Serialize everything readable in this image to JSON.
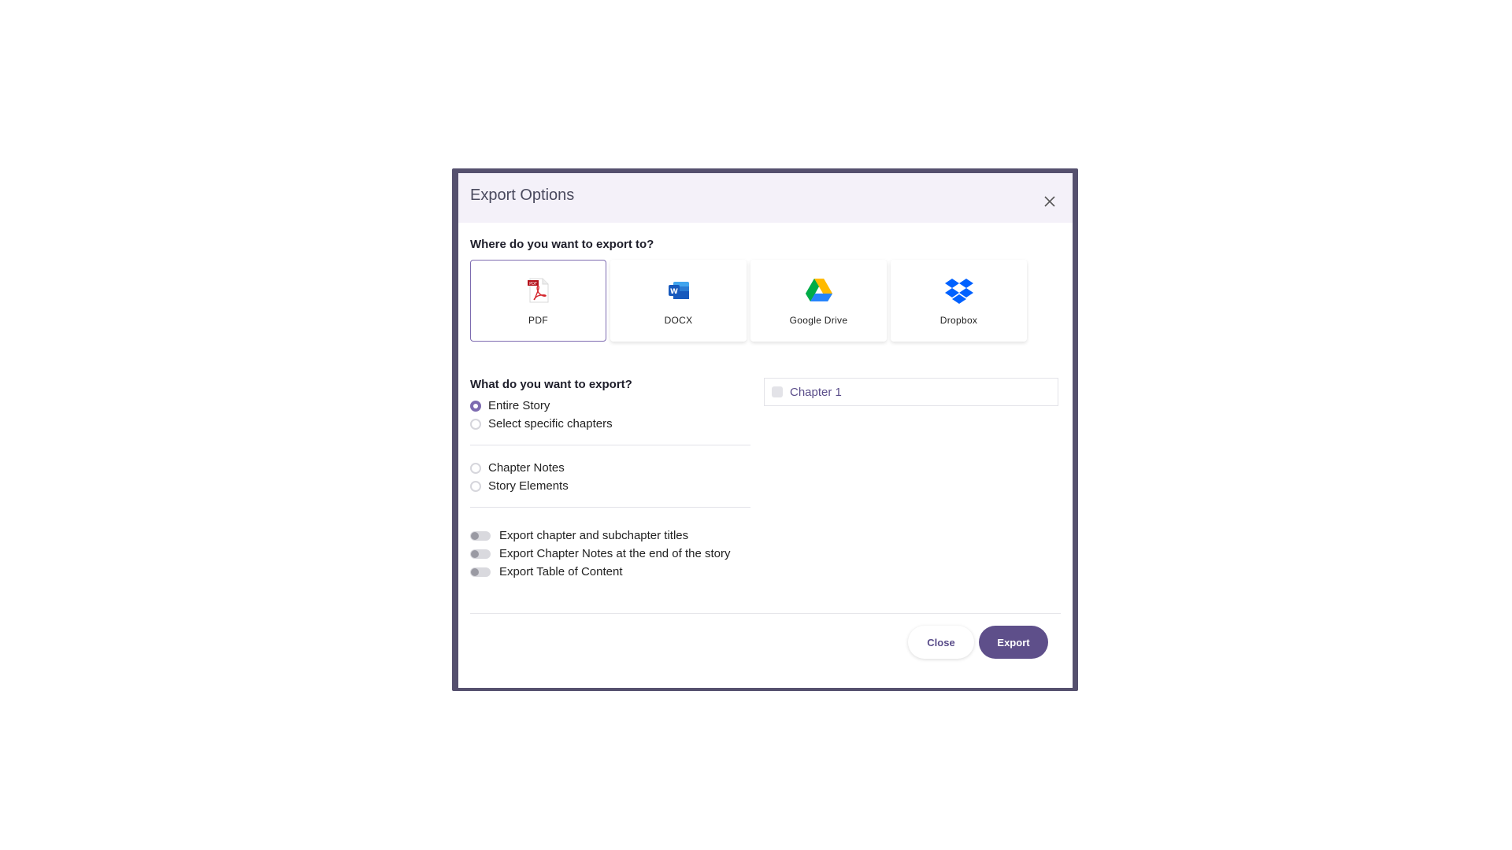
{
  "dialog": {
    "title": "Export Options",
    "close_icon": "close-icon"
  },
  "destination": {
    "question": "Where do you want to export to?",
    "options": [
      {
        "label": "PDF",
        "icon": "pdf-icon",
        "selected": true
      },
      {
        "label": "DOCX",
        "icon": "word-icon",
        "selected": false
      },
      {
        "label": "Google Drive",
        "icon": "google-drive-icon",
        "selected": false
      },
      {
        "label": "Dropbox",
        "icon": "dropbox-icon",
        "selected": false
      }
    ]
  },
  "content": {
    "question": "What do you want to export?",
    "scope_options": [
      {
        "label": "Entire Story",
        "selected": true
      },
      {
        "label": "Select specific chapters",
        "selected": false
      }
    ],
    "extra_options": [
      {
        "label": "Chapter Notes",
        "selected": false
      },
      {
        "label": "Story Elements",
        "selected": false
      }
    ],
    "toggles": [
      {
        "label": "Export chapter and subchapter titles",
        "on": false
      },
      {
        "label": "Export Chapter Notes at the end of the story",
        "on": false
      },
      {
        "label": "Export Table of Content",
        "on": false
      }
    ]
  },
  "chapters": [
    {
      "label": "Chapter 1",
      "checked": false
    }
  ],
  "footer": {
    "close_label": "Close",
    "export_label": "Export"
  },
  "colors": {
    "accent": "#5e4f8a",
    "frame": "#55506e",
    "header_bg": "#f4f1f9"
  }
}
